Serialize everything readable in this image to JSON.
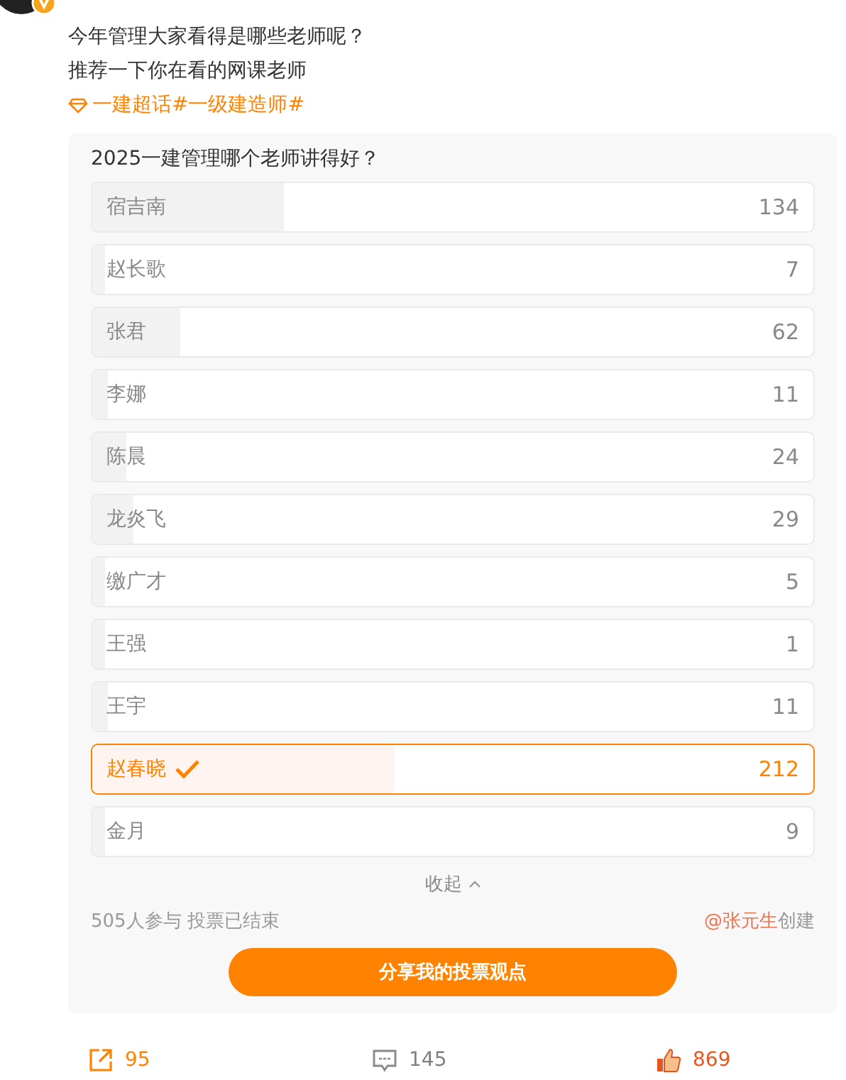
{
  "post": {
    "lines": [
      "今年管理大家看得是哪些老师呢？",
      "推荐一下你在看的网课老师"
    ],
    "topic": "一建超话#一级建造师#"
  },
  "poll": {
    "question": "2025一建管理哪个老师讲得好？",
    "options": [
      {
        "name": "宿吉南",
        "count": "134",
        "level": 0.265,
        "selected": false
      },
      {
        "name": "赵长歌",
        "count": "7",
        "level": 0.014,
        "selected": false
      },
      {
        "name": "张君",
        "count": "62",
        "level": 0.123,
        "selected": false
      },
      {
        "name": "李娜",
        "count": "11",
        "level": 0.022,
        "selected": false
      },
      {
        "name": "陈晨",
        "count": "24",
        "level": 0.048,
        "selected": false
      },
      {
        "name": "龙炎飞",
        "count": "29",
        "level": 0.057,
        "selected": false
      },
      {
        "name": "缴广才",
        "count": "5",
        "level": 0.01,
        "selected": false
      },
      {
        "name": "王强",
        "count": "1",
        "level": 0.002,
        "selected": false
      },
      {
        "name": "王宇",
        "count": "11",
        "level": 0.022,
        "selected": false
      },
      {
        "name": "赵春晓",
        "count": "212",
        "level": 0.42,
        "selected": true
      },
      {
        "name": "金月",
        "count": "9",
        "level": 0.018,
        "selected": false
      }
    ],
    "collapse": "收起",
    "participants": "505人参与 投票已结束",
    "creator": "@张元生",
    "created": "创建",
    "share_button": "分享我的投票观点"
  },
  "actions": [
    {
      "kind": "share",
      "count": "95"
    },
    {
      "kind": "comment",
      "count": "145"
    },
    {
      "kind": "like",
      "count": "869"
    }
  ]
}
